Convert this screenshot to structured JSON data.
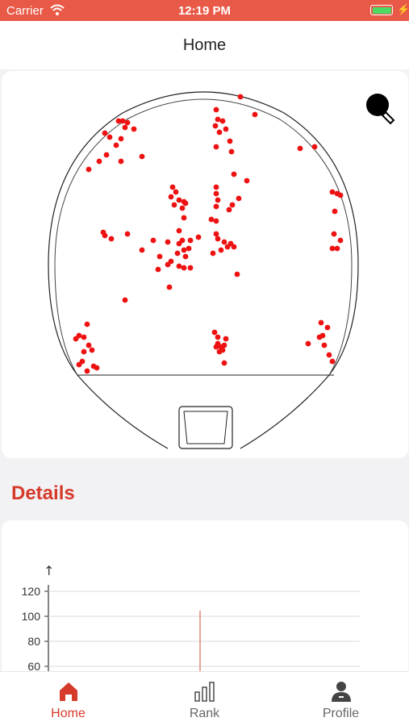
{
  "status_bar": {
    "carrier": "Carrier",
    "time": "12:19 PM",
    "battery_color": "#4cd964"
  },
  "nav": {
    "title": "Home"
  },
  "board": {
    "icon": "racket-icon",
    "hit_color": "#ee1111",
    "hits": [
      [
        298,
        120
      ],
      [
        316,
        142
      ],
      [
        268,
        136
      ],
      [
        270,
        148
      ],
      [
        276,
        150
      ],
      [
        267,
        156
      ],
      [
        280,
        160
      ],
      [
        272,
        164
      ],
      [
        285,
        175
      ],
      [
        268,
        182
      ],
      [
        287,
        188
      ],
      [
        290,
        216
      ],
      [
        306,
        224
      ],
      [
        147,
        150
      ],
      [
        152,
        150
      ],
      [
        158,
        152
      ],
      [
        155,
        158
      ],
      [
        166,
        160
      ],
      [
        130,
        165
      ],
      [
        136,
        170
      ],
      [
        150,
        172
      ],
      [
        144,
        180
      ],
      [
        132,
        192
      ],
      [
        176,
        194
      ],
      [
        123,
        200
      ],
      [
        150,
        200
      ],
      [
        110,
        210
      ],
      [
        372,
        184
      ],
      [
        390,
        182
      ],
      [
        214,
        232
      ],
      [
        218,
        238
      ],
      [
        212,
        244
      ],
      [
        222,
        248
      ],
      [
        228,
        250
      ],
      [
        230,
        252
      ],
      [
        216,
        254
      ],
      [
        226,
        258
      ],
      [
        228,
        270
      ],
      [
        222,
        286
      ],
      [
        268,
        232
      ],
      [
        268,
        240
      ],
      [
        270,
        248
      ],
      [
        296,
        246
      ],
      [
        288,
        254
      ],
      [
        284,
        260
      ],
      [
        268,
        256
      ],
      [
        262,
        272
      ],
      [
        268,
        274
      ],
      [
        268,
        290
      ],
      [
        412,
        238
      ],
      [
        418,
        240
      ],
      [
        422,
        242
      ],
      [
        415,
        262
      ],
      [
        414,
        290
      ],
      [
        422,
        298
      ],
      [
        412,
        308
      ],
      [
        418,
        308
      ],
      [
        128,
        288
      ],
      [
        130,
        292
      ],
      [
        138,
        296
      ],
      [
        158,
        290
      ],
      [
        190,
        298
      ],
      [
        176,
        310
      ],
      [
        208,
        300
      ],
      [
        222,
        302
      ],
      [
        226,
        298
      ],
      [
        236,
        298
      ],
      [
        246,
        294
      ],
      [
        234,
        308
      ],
      [
        228,
        310
      ],
      [
        220,
        314
      ],
      [
        230,
        318
      ],
      [
        198,
        318
      ],
      [
        208,
        328
      ],
      [
        212,
        324
      ],
      [
        222,
        330
      ],
      [
        228,
        332
      ],
      [
        236,
        332
      ],
      [
        196,
        334
      ],
      [
        210,
        356
      ],
      [
        270,
        296
      ],
      [
        278,
        300
      ],
      [
        286,
        302
      ],
      [
        282,
        306
      ],
      [
        290,
        306
      ],
      [
        274,
        310
      ],
      [
        264,
        314
      ],
      [
        294,
        340
      ],
      [
        155,
        372
      ],
      [
        108,
        402
      ],
      [
        98,
        416
      ],
      [
        94,
        420
      ],
      [
        104,
        418
      ],
      [
        110,
        428
      ],
      [
        114,
        434
      ],
      [
        104,
        436
      ],
      [
        102,
        448
      ],
      [
        98,
        452
      ],
      [
        116,
        454
      ],
      [
        120,
        456
      ],
      [
        108,
        460
      ],
      [
        398,
        400
      ],
      [
        406,
        406
      ],
      [
        400,
        416
      ],
      [
        396,
        418
      ],
      [
        382,
        426
      ],
      [
        402,
        428
      ],
      [
        408,
        440
      ],
      [
        412,
        448
      ],
      [
        266,
        412
      ],
      [
        270,
        418
      ],
      [
        280,
        420
      ],
      [
        270,
        426
      ],
      [
        274,
        430
      ],
      [
        276,
        434
      ],
      [
        272,
        436
      ],
      [
        268,
        430
      ],
      [
        278,
        428
      ],
      [
        278,
        450
      ]
    ]
  },
  "details": {
    "title": "Details"
  },
  "chart_data": {
    "type": "line",
    "y_axis_marker": "↑",
    "yticks": [
      120,
      100,
      80,
      60
    ],
    "grid": true,
    "visible_ylim": [
      60,
      120
    ],
    "series": [
      {
        "color": "#d94c3a",
        "x_index": 0,
        "note_line": "single vertical marker extending from top to bottom of visible plot"
      }
    ]
  },
  "tabs": [
    {
      "label": "Home",
      "icon": "home-icon",
      "active": true
    },
    {
      "label": "Rank",
      "icon": "bar-chart-icon",
      "active": false
    },
    {
      "label": "Profile",
      "icon": "profile-icon",
      "active": false
    }
  ]
}
